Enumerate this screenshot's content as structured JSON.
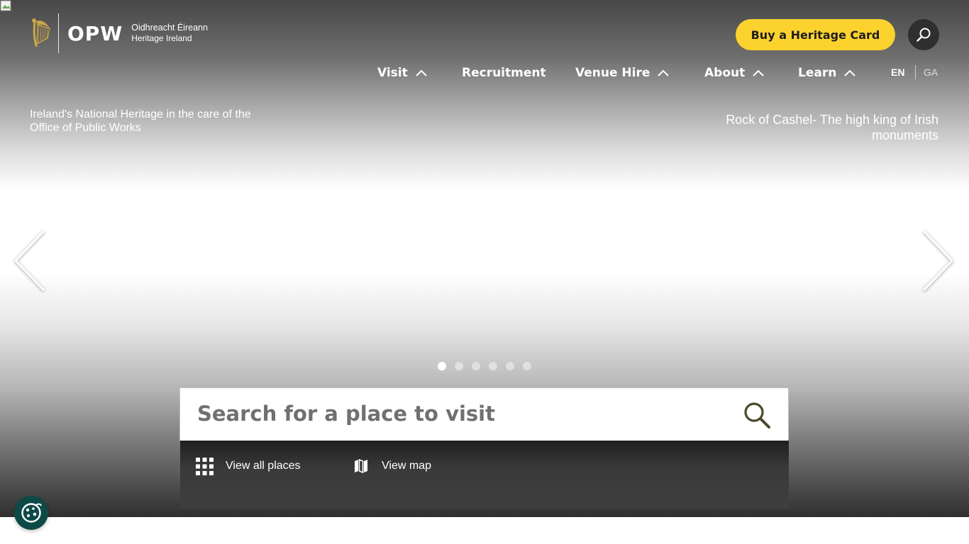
{
  "brand": {
    "logo_text": "OPW",
    "subtitle_irish": "Oidhreacht Éireann",
    "subtitle_english": "Heritage Ireland"
  },
  "header": {
    "cta_label": "Buy a Heritage Card",
    "search_icon": "search-icon"
  },
  "nav": {
    "items": [
      {
        "label": "Visit",
        "icon": "chevron-up-icon"
      },
      {
        "label": "Recruitment",
        "icon": ""
      },
      {
        "label": "Venue Hire",
        "icon": "chevron-up-icon"
      },
      {
        "label": "About",
        "icon": "chevron-up-icon"
      },
      {
        "label": "Learn",
        "icon": "chevron-up-icon"
      }
    ],
    "languages": [
      {
        "code": "EN",
        "active": true
      },
      {
        "code": "GA",
        "active": false
      }
    ]
  },
  "hero": {
    "tagline": "Ireland's National Heritage in the care of the Office of Public Works",
    "slide_caption": "Rock of Cashel- The high king of Irish monuments",
    "slide_count": 6,
    "active_slide": 1
  },
  "search": {
    "placeholder": "Search for a place to visit",
    "view_all_label": "View all places",
    "view_map_label": "View map"
  },
  "colors": {
    "accent_yellow": "#fcd22e",
    "cookie_badge": "#0d4a47",
    "search_icon_color": "#4a4a2a"
  }
}
